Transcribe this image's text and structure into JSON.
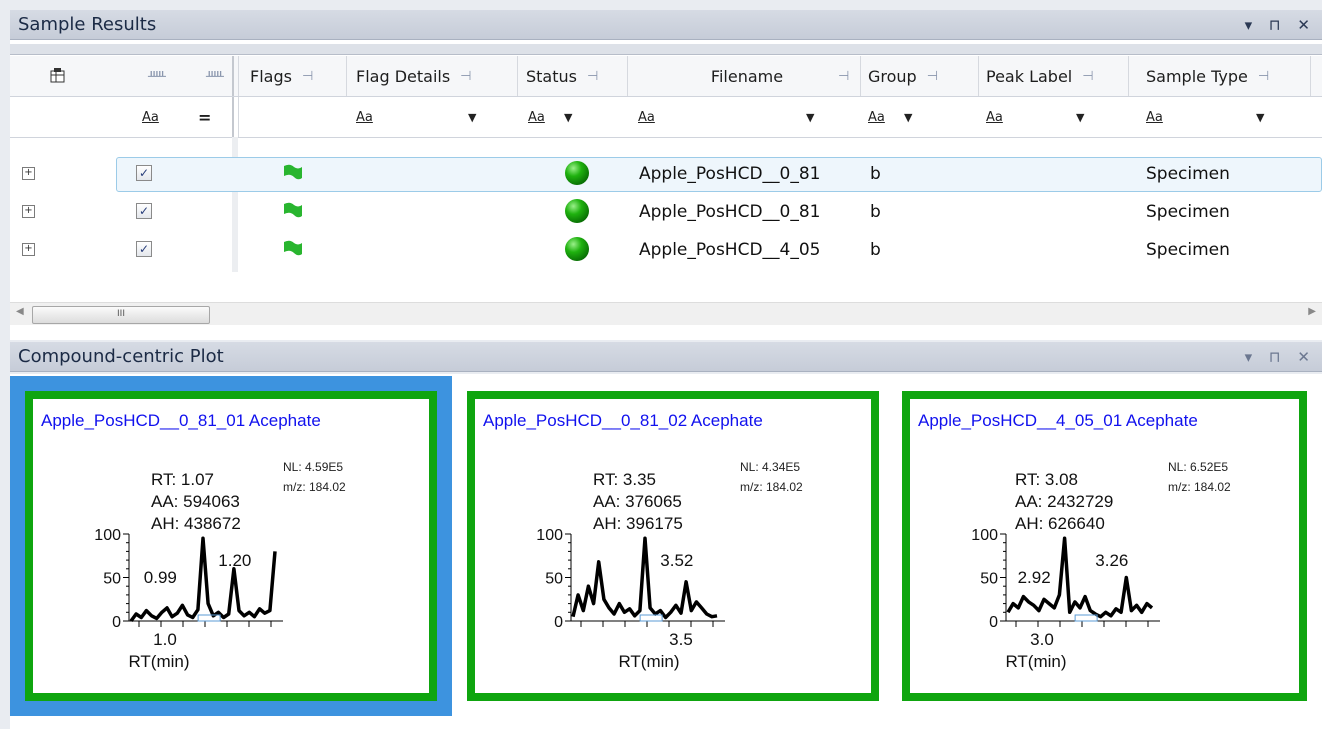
{
  "sample_results": {
    "title": "Sample Results",
    "controls": {
      "dropdown": "▾",
      "pin": "⊓",
      "close": "✕"
    },
    "columns": [
      {
        "label": ""
      },
      {
        "label": ""
      },
      {
        "label": ""
      },
      {
        "label": "Flags"
      },
      {
        "label": "Flag Details"
      },
      {
        "label": "Status"
      },
      {
        "label": "Filename"
      },
      {
        "label": "Group"
      },
      {
        "label": "Peak Label"
      },
      {
        "label": "Sample Type"
      }
    ],
    "filter": {
      "aa": "Aa",
      "equals": "="
    },
    "rows": [
      {
        "checked": true,
        "status_color": "#1fb20f",
        "filename": "Apple_PosHCD__0_81",
        "group": "b",
        "sample_type": "Specimen",
        "selected": true
      },
      {
        "checked": true,
        "status_color": "#1fb20f",
        "filename": "Apple_PosHCD__0_81",
        "group": "b",
        "sample_type": "Specimen",
        "selected": false
      },
      {
        "checked": true,
        "status_color": "#1fb20f",
        "filename": "Apple_PosHCD__4_05",
        "group": "b",
        "sample_type": "Specimen",
        "selected": false
      }
    ],
    "scroll_thumb_glyph": "III"
  },
  "compound_plot": {
    "title": "Compound-centric Plot",
    "cards": [
      {
        "title": "Apple_PosHCD__0_81_01   Acephate",
        "nl": "NL: 4.59E5",
        "mz": "m/z: 184.02",
        "rt": "RT: 1.07",
        "aa": "AA: 594063",
        "ah": "AH: 438672",
        "peak_left": "0.99",
        "peak_right": "1.20",
        "x_tick": "1.0",
        "xlabel": "RT(min)",
        "y_ticks": [
          "100",
          "50",
          "0"
        ],
        "trace": [
          0,
          8,
          4,
          12,
          6,
          3,
          10,
          15,
          5,
          9,
          18,
          7,
          4,
          13,
          95,
          20,
          6,
          10,
          4,
          8,
          60,
          12,
          6,
          10,
          5,
          14,
          9,
          12,
          80
        ],
        "active": true
      },
      {
        "title": "Apple_PosHCD__0_81_02   Acephate",
        "nl": "NL: 4.34E5",
        "mz": "m/z: 184.02",
        "rt": "RT: 3.35",
        "aa": "AA: 376065",
        "ah": "AH: 396175",
        "peak_left": "",
        "peak_right": "3.52",
        "x_tick": "3.5",
        "xlabel": "RT(min)",
        "y_ticks": [
          "100",
          "50",
          "0"
        ],
        "trace": [
          5,
          30,
          12,
          40,
          20,
          68,
          25,
          15,
          8,
          20,
          10,
          14,
          6,
          12,
          95,
          15,
          8,
          12,
          4,
          10,
          18,
          9,
          45,
          12,
          22,
          15,
          8,
          5,
          6
        ],
        "active": false
      },
      {
        "title": "Apple_PosHCD__4_05_01   Acephate",
        "nl": "NL: 6.52E5",
        "mz": "m/z: 184.02",
        "rt": "RT: 3.08",
        "aa": "AA: 2432729",
        "ah": "AH: 626640",
        "peak_left": "2.92",
        "peak_right": "3.26",
        "x_tick": "3.0",
        "xlabel": "RT(min)",
        "y_ticks": [
          "100",
          "50",
          "0"
        ],
        "trace": [
          10,
          20,
          15,
          28,
          22,
          18,
          12,
          25,
          20,
          15,
          30,
          95,
          10,
          22,
          15,
          28,
          12,
          8,
          5,
          10,
          6,
          14,
          10,
          50,
          12,
          18,
          10,
          20,
          15
        ],
        "active": false
      }
    ]
  }
}
